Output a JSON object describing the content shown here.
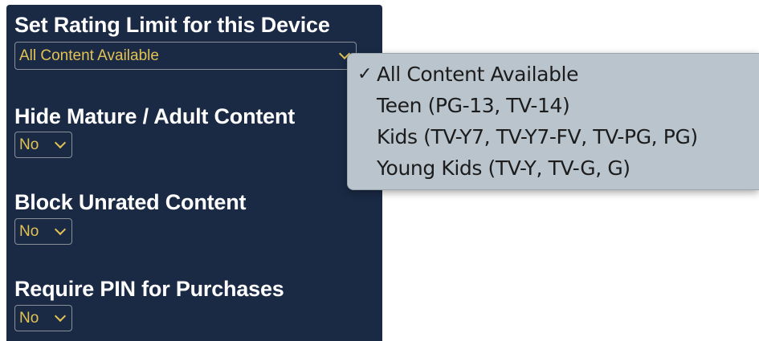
{
  "settings": {
    "rating_limit": {
      "label": "Set Rating Limit for this Device",
      "value": "All Content Available"
    },
    "hide_mature": {
      "label": "Hide Mature / Adult Content",
      "value": "No"
    },
    "block_unrated": {
      "label": "Block Unrated Content",
      "value": "No"
    },
    "require_pin": {
      "label": "Require PIN for Purchases",
      "value": "No"
    }
  },
  "dropdown": {
    "check": "✓",
    "options": [
      {
        "label": "All Content Available",
        "selected": true
      },
      {
        "label": "Teen (PG-13, TV-14)",
        "selected": false
      },
      {
        "label": "Kids (TV-Y7, TV-Y7-FV, TV-PG, PG)",
        "selected": false
      },
      {
        "label": "Young Kids (TV-Y, TV-G, G)",
        "selected": false
      }
    ]
  },
  "colors": {
    "panel_bg": "#1a2a45",
    "select_text": "#e3c254",
    "menu_bg": "#b9c4cd"
  },
  "icons": {
    "select_arrow": "chevron-down-icon",
    "selected_mark": "checkmark-icon"
  }
}
